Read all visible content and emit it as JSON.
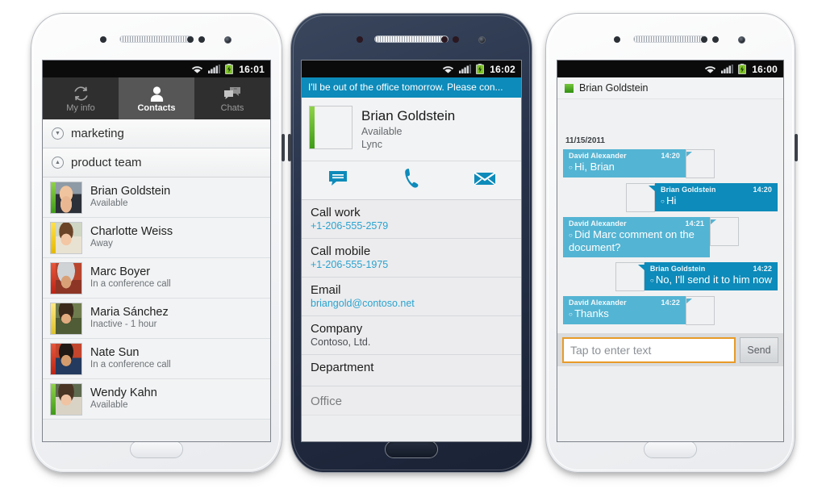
{
  "phone1": {
    "device_color": "#f4f5f7",
    "statusbar": {
      "wifi": "wifi-icon",
      "signal": "signal-icon",
      "battery": "battery-charging-icon",
      "clock": "16:01"
    },
    "tabs": [
      {
        "id": "my-info",
        "label": "My info",
        "icon": "sync-arrows-icon",
        "selected": false
      },
      {
        "id": "contacts",
        "label": "Contacts",
        "icon": "person-icon",
        "selected": true
      },
      {
        "id": "chats",
        "label": "Chats",
        "icon": "chat-bubbles-icon",
        "selected": false
      }
    ],
    "groups": [
      {
        "name": "marketing",
        "expanded": false,
        "chevron": "chevron-down-icon"
      },
      {
        "name": "product team",
        "expanded": true,
        "chevron": "chevron-up-icon"
      }
    ],
    "contacts": [
      {
        "name": "Brian Goldstein",
        "status": "Available",
        "presence": "available",
        "presence_color": "#5cb21f",
        "face": "f-brian"
      },
      {
        "name": "Charlotte Weiss",
        "status": "Away",
        "presence": "away",
        "presence_color": "#f2c400",
        "face": "f-charlotte"
      },
      {
        "name": "Marc Boyer",
        "status": "In a conference call",
        "presence": "busy",
        "presence_color": "#cf3620",
        "face": "f-marc"
      },
      {
        "name": "Maria Sánchez",
        "status": "Inactive - 1 hour",
        "presence": "inactive",
        "presence_color": "#eed845",
        "face": "f-maria"
      },
      {
        "name": "Nate Sun",
        "status": "In a conference call",
        "presence": "busy",
        "presence_color": "#cf3620",
        "face": "f-nate"
      },
      {
        "name": "Wendy Kahn",
        "status": "Available",
        "presence": "available",
        "presence_color": "#5cb21f",
        "face": "f-wendy"
      }
    ]
  },
  "phone2": {
    "device_color": "#27324a",
    "statusbar": {
      "clock": "16:02"
    },
    "note": "I'll be out of the office tomorrow. Please con...",
    "note_color": "#0d8bba",
    "contact": {
      "name": "Brian Goldstein",
      "availability": "Available",
      "source": "Lync",
      "presence": "available",
      "face": "f-brian"
    },
    "actions": [
      {
        "id": "chat",
        "icon": "chat-bubble-icon"
      },
      {
        "id": "call",
        "icon": "phone-icon"
      },
      {
        "id": "email",
        "icon": "envelope-icon"
      }
    ],
    "fields": [
      {
        "label": "Call work",
        "value": "+1-206-555-2579",
        "kind": "link"
      },
      {
        "label": "Call mobile",
        "value": "+1-206-555-1975",
        "kind": "link"
      },
      {
        "label": "Email",
        "value": "briangold@contoso.net",
        "kind": "link"
      },
      {
        "label": "Company",
        "value": "Contoso, Ltd.",
        "kind": "plain"
      },
      {
        "label": "Department",
        "value": "",
        "kind": "plain"
      },
      {
        "label": "Office",
        "value": "",
        "kind": "plain"
      }
    ]
  },
  "phone3": {
    "device_color": "#f4f5f7",
    "statusbar": {
      "clock": "16:00"
    },
    "header": {
      "title": "Brian Goldstein",
      "presence": "available"
    },
    "datestamp": "11/15/2011",
    "messages": [
      {
        "sender": "David Alexander",
        "time": "14:20",
        "text": "Hi, Brian",
        "side": "in",
        "bubble_color": "#54b4d3",
        "face": "f-david"
      },
      {
        "sender": "Brian Goldstein",
        "time": "14:20",
        "text": "Hi",
        "side": "out",
        "bubble_color": "#0d8bba",
        "face": "f-brian"
      },
      {
        "sender": "David Alexander",
        "time": "14:21",
        "text": "Did Marc comment on the document?",
        "side": "in",
        "bubble_color": "#54b4d3",
        "face": "f-david"
      },
      {
        "sender": "Brian Goldstein",
        "time": "14:22",
        "text": "No, I'll send it to him now",
        "side": "out",
        "bubble_color": "#0d8bba",
        "face": "f-brian"
      },
      {
        "sender": "David Alexander",
        "time": "14:22",
        "text": "Thanks",
        "side": "in",
        "bubble_color": "#54b4d3",
        "face": "f-david"
      }
    ],
    "composer": {
      "placeholder": "Tap to enter text",
      "value": "",
      "send_label": "Send",
      "focus_color": "#e79a28"
    }
  }
}
